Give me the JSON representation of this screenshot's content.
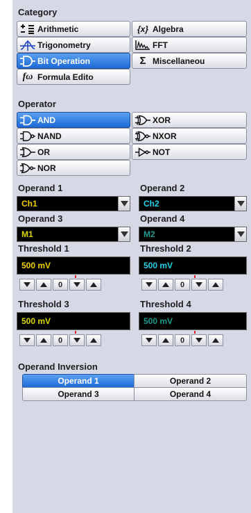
{
  "category": {
    "title": "Category",
    "items": [
      {
        "label": "Arithmetic",
        "icon": "arithmetic-icon",
        "selected": false
      },
      {
        "label": "Algebra",
        "icon": "algebra-icon",
        "selected": false
      },
      {
        "label": "Trigonometry",
        "icon": "trigonometry-icon",
        "selected": false
      },
      {
        "label": "FFT",
        "icon": "fft-icon",
        "selected": false
      },
      {
        "label": "Bit Operation",
        "icon": "bit-operation-icon",
        "selected": true
      },
      {
        "label": "Miscellaneou",
        "icon": "sigma-icon",
        "selected": false
      },
      {
        "label": "Formula Edito",
        "icon": "formula-icon",
        "selected": false
      }
    ]
  },
  "operator": {
    "title": "Operator",
    "items": [
      {
        "label": "AND",
        "icon": "and-gate-icon",
        "selected": true
      },
      {
        "label": "XOR",
        "icon": "xor-gate-icon",
        "selected": false
      },
      {
        "label": "NAND",
        "icon": "nand-gate-icon",
        "selected": false
      },
      {
        "label": "NXOR",
        "icon": "nxor-gate-icon",
        "selected": false
      },
      {
        "label": "OR",
        "icon": "or-gate-icon",
        "selected": false
      },
      {
        "label": "NOT",
        "icon": "not-gate-icon",
        "selected": false
      },
      {
        "label": "NOR",
        "icon": "nor-gate-icon",
        "selected": false
      }
    ]
  },
  "operands": [
    {
      "label": "Operand 1",
      "value": "Ch1",
      "color": "#f0d000"
    },
    {
      "label": "Operand 2",
      "value": "Ch2",
      "color": "#24d0e8"
    },
    {
      "label": "Operand 3",
      "value": "M1",
      "color": "#d8d800"
    },
    {
      "label": "Operand 4",
      "value": "M2",
      "color": "#1e9a8c"
    }
  ],
  "thresholds": [
    {
      "label": "Threshold 1",
      "value": "500 mV",
      "color": "#f0d000"
    },
    {
      "label": "Threshold 2",
      "value": "500 mV",
      "color": "#24d0e8"
    },
    {
      "label": "Threshold 3",
      "value": "500 mV",
      "color": "#d8d800"
    },
    {
      "label": "Threshold 4",
      "value": "500 mV",
      "color": "#1e9a8c"
    }
  ],
  "spinner": {
    "zero_label": "0"
  },
  "inversion": {
    "title": "Operand Inversion",
    "items": [
      {
        "label": "Operand 1",
        "selected": true
      },
      {
        "label": "Operand 2",
        "selected": false
      },
      {
        "label": "Operand 3",
        "selected": false
      },
      {
        "label": "Operand 4",
        "selected": false
      }
    ]
  },
  "colors": {
    "panel": "#d7d8e6",
    "selected": "#2a78e0"
  }
}
